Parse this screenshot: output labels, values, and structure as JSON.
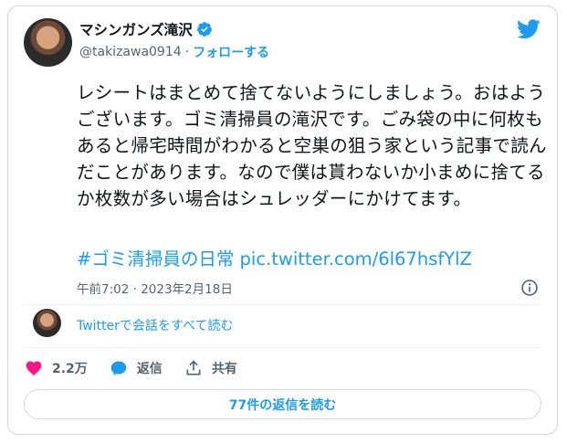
{
  "author": {
    "display_name": "マシンガンズ滝沢",
    "handle": "@takizawa0914",
    "separator": "·",
    "follow_label": "フォローする"
  },
  "tweet": {
    "text": "レシートはまとめて捨てないようにしましょう。おはようございます。ゴミ清掃員の滝沢です。ごみ袋の中に何枚もあると帰宅時間がわかると空巣の狙う家という記事で読んだことがあります。なので僕は貰わないか小まめに捨てるか枚数が多い場合はシュレッダーにかけてます。",
    "hashtag": "#ゴミ清掃員の日常",
    "link": "pic.twitter.com/6l67hsfYlZ",
    "timestamp": "午前7:02 · 2023年2月18日"
  },
  "conversation": {
    "read_all_label": "Twitterで会話をすべて読む"
  },
  "actions": {
    "like_count": "2.2万",
    "reply_label": "返信",
    "share_label": "共有"
  },
  "replies_button": {
    "label": "77件の返信を読む"
  },
  "colors": {
    "accent": "#1d9bf0",
    "like": "#f91880",
    "text": "#0f1419",
    "muted": "#536471"
  },
  "icons": [
    "verified-badge-icon",
    "twitter-bird-icon",
    "info-icon",
    "heart-icon",
    "reply-icon",
    "share-icon"
  ]
}
